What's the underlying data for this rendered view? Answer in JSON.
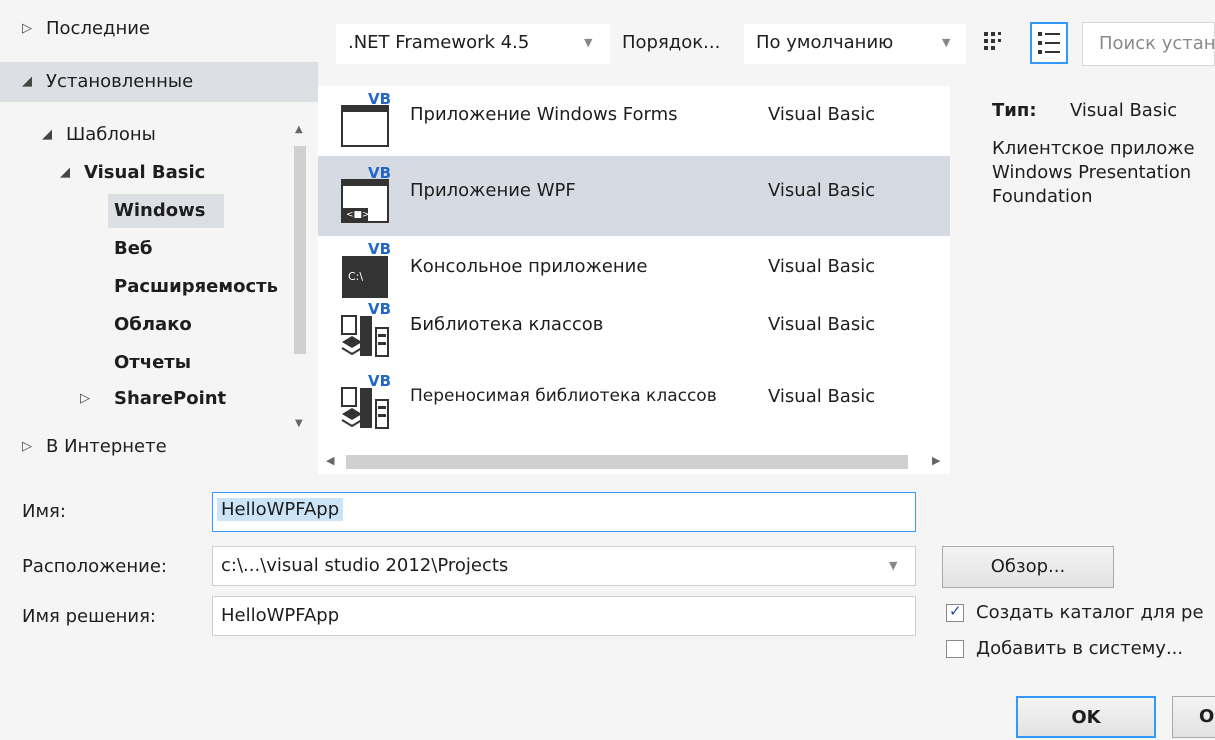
{
  "left_tree": {
    "recent": "Последние",
    "installed": "Установленные",
    "templates": "Шаблоны",
    "visual_basic": "Visual Basic",
    "windows": "Windows",
    "web": "Веб",
    "extensibility": "Расширяемость",
    "cloud": "Облако",
    "reports": "Отчеты",
    "sharepoint": "SharePoint",
    "online": "В Интернете"
  },
  "toolbar": {
    "framework": ".NET Framework 4.5",
    "sort_label": "Порядок...",
    "sort_value": "По умолчанию",
    "search_placeholder": "Поиск устан"
  },
  "templates": [
    {
      "name": "Приложение Windows Forms",
      "lang": "Visual Basic",
      "selected": false
    },
    {
      "name": "Приложение WPF",
      "lang": "Visual Basic",
      "selected": true
    },
    {
      "name": "Консольное приложение",
      "lang": "Visual Basic",
      "selected": false
    },
    {
      "name": "Библиотека классов",
      "lang": "Visual Basic",
      "selected": false
    },
    {
      "name": "Переносимая библиотека классов",
      "lang": "Visual Basic",
      "selected": false
    }
  ],
  "description": {
    "type_label": "Тип:",
    "type_value": "Visual Basic",
    "line1": "Клиентское приложе",
    "line2": "Windows Presentation",
    "line3": "Foundation"
  },
  "form": {
    "name_label": "Имя:",
    "name_value": "HelloWPFApp",
    "location_label": "Расположение:",
    "location_value": "c:\\...\\visual studio 2012\\Projects",
    "solution_label": "Имя решения:",
    "solution_value": "HelloWPFApp",
    "browse_label": "Обзор...",
    "create_dir_label": "Создать каталог для ре",
    "add_to_scm_label": "Добавить в систему...",
    "ok_label": "OK",
    "cancel_label": "О"
  },
  "icons": {
    "vb_badge": "VB",
    "console_glyph": "C:\\",
    "wpf_glyph": "<■>"
  },
  "colors": {
    "selection": "#d6dbe3",
    "panel": "#f5f5f5",
    "accent": "#3399ff"
  }
}
